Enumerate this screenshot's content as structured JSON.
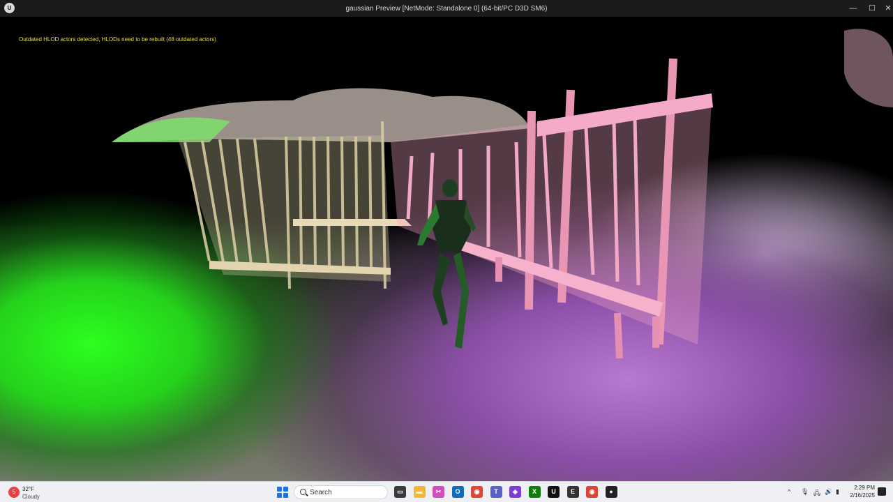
{
  "window": {
    "title": "gaussian Preview [NetMode: Standalone 0]  (64-bit/PC D3D SM6)",
    "logo_icon": "unreal-engine-logo",
    "controls": [
      "minimize-icon",
      "maximize-icon",
      "close-icon"
    ],
    "minimize_glyph": "—",
    "maximize_glyph": "☐",
    "close_glyph": "✕"
  },
  "viewport": {
    "hlod_message": "Outdated HLOD actors detected, HLODs need to be rebuilt (48 outdated actors)"
  },
  "taskbar": {
    "weather": {
      "badge": "5",
      "temp": "32°F",
      "condition": "Cloudy"
    },
    "search_placeholder": "Search",
    "apps": [
      {
        "name": "task-view-icon",
        "color": "#3a3a3a",
        "glyph": "▭"
      },
      {
        "name": "file-explorer-icon",
        "color": "#f2b736",
        "glyph": "▬"
      },
      {
        "name": "snipping-tool-icon",
        "color": "#d14fb8",
        "glyph": "✂"
      },
      {
        "name": "outlook-icon",
        "color": "#0f6cbd",
        "glyph": "O"
      },
      {
        "name": "chrome-icon",
        "color": "#e84335",
        "glyph": "◉"
      },
      {
        "name": "teams-icon",
        "color": "#5b5fc7",
        "glyph": "T"
      },
      {
        "name": "clipchamp-icon",
        "color": "#7b3fd6",
        "glyph": "◈"
      },
      {
        "name": "xbox-icon",
        "color": "#107c10",
        "glyph": "X"
      },
      {
        "name": "unreal-engine-icon",
        "color": "#111111",
        "glyph": "U"
      },
      {
        "name": "epic-launcher-icon",
        "color": "#333333",
        "glyph": "E"
      },
      {
        "name": "chrome-profile-icon",
        "color": "#db4437",
        "glyph": "◉"
      },
      {
        "name": "app-icon",
        "color": "#222222",
        "glyph": "●"
      }
    ],
    "tray_icons": [
      "chevron-up-icon",
      "microphone-icon",
      "network-icon",
      "volume-icon",
      "battery-icon"
    ],
    "tray_glyphs": [
      "^",
      "🎙",
      "🖧",
      "🔊",
      "▮"
    ],
    "time": "2:29 PM",
    "date": "2/16/2025"
  }
}
